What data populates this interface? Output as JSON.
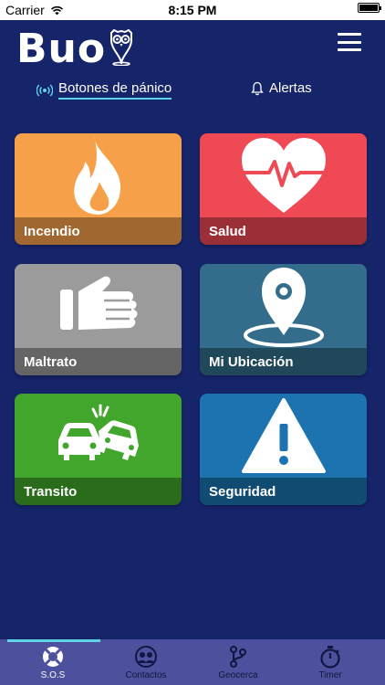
{
  "status_bar": {
    "carrier": "Carrier",
    "time": "8:15 PM"
  },
  "header": {
    "logo_text": "Buo"
  },
  "tabs": [
    {
      "label": "Botones de pánico",
      "active": true
    },
    {
      "label": "Alertas",
      "active": false
    }
  ],
  "cards": [
    {
      "label": "Incendio",
      "color": "#f6a04a",
      "icon": "flame-icon"
    },
    {
      "label": "Salud",
      "color": "#ef4955",
      "icon": "heartbeat-icon"
    },
    {
      "label": "Maltrato",
      "color": "#9b9b9b",
      "icon": "fist-icon"
    },
    {
      "label": "Mi Ubicación",
      "color": "#346d8c",
      "icon": "location-pin-icon"
    },
    {
      "label": "Transito",
      "color": "#41a62b",
      "icon": "car-crash-icon"
    },
    {
      "label": "Seguridad",
      "color": "#1c73b0",
      "icon": "warning-icon"
    }
  ],
  "bottom_nav": [
    {
      "label": "S.O.S",
      "icon": "lifebuoy-icon",
      "active": true
    },
    {
      "label": "Contactos",
      "icon": "contacts-icon",
      "active": false
    },
    {
      "label": "Geocerca",
      "icon": "geofence-icon",
      "active": false
    },
    {
      "label": "Timer",
      "icon": "stopwatch-icon",
      "active": false
    }
  ],
  "colors": {
    "background": "#16246a",
    "bottom_bar": "#4d519d",
    "accent": "#5fd3e8"
  }
}
